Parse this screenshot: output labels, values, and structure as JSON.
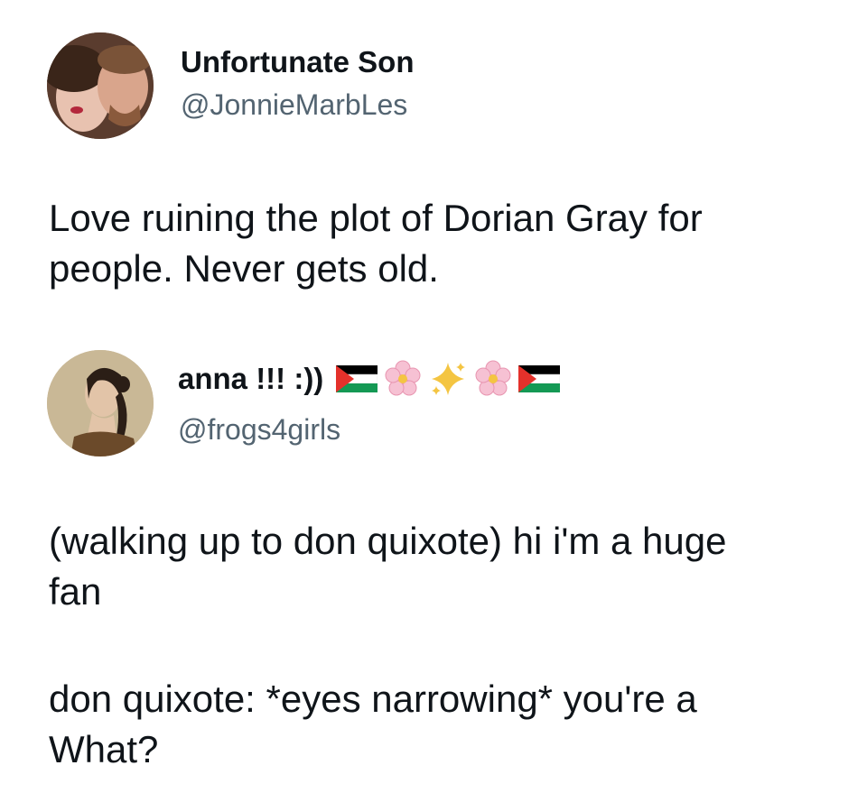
{
  "tweets": [
    {
      "display_name": "Unfortunate Son",
      "handle": "@JonnieMarbLes",
      "body": "Love ruining the plot of Dorian Gray for people. Never gets old."
    },
    {
      "display_name": "anna !!! :))",
      "name_emojis": [
        "palestine-flag",
        "cherry-blossom",
        "sparkles",
        "cherry-blossom",
        "palestine-flag"
      ],
      "handle": "@frogs4girls",
      "body_paragraphs": [
        "(walking up to don quixote) hi i'm a huge fan",
        "don quixote: *eyes narrowing* you're a What?"
      ]
    }
  ],
  "colors": {
    "text": "#0f1419",
    "handle": "#536471",
    "background": "#ffffff",
    "flag_red": "#e4312b",
    "flag_green": "#149954",
    "flower_pink": "#f6c1d3",
    "sparkle_gold": "#f4c542"
  }
}
